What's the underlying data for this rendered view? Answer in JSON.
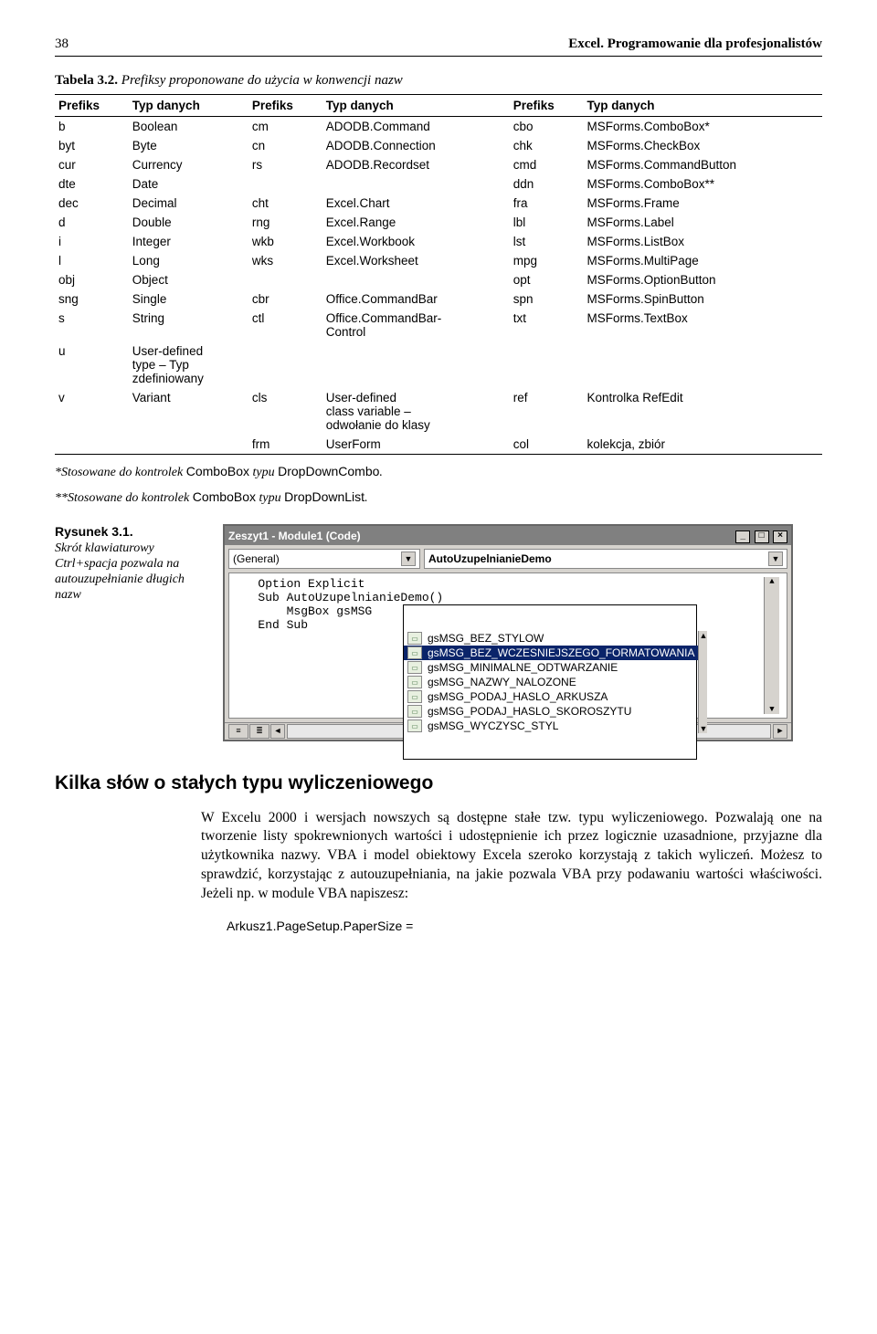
{
  "header": {
    "page": "38",
    "title": "Excel. Programowanie dla profesjonalistów"
  },
  "table_caption_bold": "Tabela 3.2.",
  "table_caption_italic": "Prefiksy proponowane do użycia w konwencji nazw",
  "th": [
    "Prefiks",
    "Typ danych",
    "Prefiks",
    "Typ danych",
    "Prefiks",
    "Typ danych"
  ],
  "rows": [
    [
      "b",
      "Boolean",
      "cm",
      "ADODB.Command",
      "cbo",
      "MSForms.ComboBox*"
    ],
    [
      "byt",
      "Byte",
      "cn",
      "ADODB.Connection",
      "chk",
      "MSForms.CheckBox"
    ],
    [
      "cur",
      "Currency",
      "rs",
      "ADODB.Recordset",
      "cmd",
      "MSForms.CommandButton"
    ],
    [
      "dte",
      "Date",
      "",
      "",
      "ddn",
      "MSForms.ComboBox**"
    ],
    [
      "dec",
      "Decimal",
      "cht",
      "Excel.Chart",
      "fra",
      "MSForms.Frame"
    ],
    [
      "d",
      "Double",
      "rng",
      "Excel.Range",
      "lbl",
      "MSForms.Label"
    ],
    [
      "i",
      "Integer",
      "wkb",
      "Excel.Workbook",
      "lst",
      "MSForms.ListBox"
    ],
    [
      "l",
      "Long",
      "wks",
      "Excel.Worksheet",
      "mpg",
      "MSForms.MultiPage"
    ],
    [
      "obj",
      "Object",
      "",
      "",
      "opt",
      "MSForms.OptionButton"
    ],
    [
      "sng",
      "Single",
      "cbr",
      "Office.CommandBar",
      "spn",
      "MSForms.SpinButton"
    ],
    [
      "s",
      "String",
      "ctl",
      "Office.CommandBar-\nControl",
      "txt",
      "MSForms.TextBox"
    ],
    [
      "u",
      "User-defined\ntype – Typ\nzdefiniowany",
      "",
      "",
      "",
      ""
    ],
    [
      "v",
      "Variant",
      "cls",
      "User-defined\nclass variable –\nodwołanie do klasy",
      "ref",
      "Kontrolka RefEdit"
    ],
    [
      "",
      "",
      "frm",
      "UserForm",
      "col",
      "kolekcja, zbiór"
    ]
  ],
  "footnote1_a": "*Stosowane do kontrolek ",
  "footnote1_b": "ComboBox",
  "footnote1_c": " typu ",
  "footnote1_d": "DropDownCombo",
  "footnote1_e": ".",
  "footnote2_a": "**Stosowane do kontrolek ",
  "footnote2_b": "ComboBox",
  "footnote2_c": " typu ",
  "footnote2_d": "DropDownList",
  "footnote2_e": ".",
  "fig_label": "Rysunek 3.1.",
  "fig_text": "Skrót klawiaturowy Ctrl+spacja pozwala na autouzupełnianie długich nazw",
  "ss": {
    "title": "Zeszyt1 - Module1 (Code)",
    "dd_left": "(General)",
    "dd_right": "AutoUzupelnianieDemo",
    "code_lines": [
      "   Option Explicit",
      "   Sub AutoUzupelnianieDemo()",
      "       MsgBox gsMSG",
      "   End Sub"
    ],
    "ac": [
      "gsMSG_BEZ_STYLOW",
      "gsMSG_BEZ_WCZESNIEJSZEGO_FORMATOWANIA",
      "gsMSG_MINIMALNE_ODTWARZANIE",
      "gsMSG_NAZWY_NALOZONE",
      "gsMSG_PODAJ_HASLO_ARKUSZA",
      "gsMSG_PODAJ_HASLO_SKOROSZYTU",
      "gsMSG_WYCZYSC_STYL"
    ],
    "ac_selected": 1
  },
  "section": "Kilka słów o stałych typu wyliczeniowego",
  "paragraph": "W Excelu 2000 i wersjach nowszych są dostępne stałe tzw. typu wyliczeniowego. Pozwalają one na tworzenie listy spokrewnionych wartości i udostępnienie ich przez logicznie uzasadnione, przyjazne dla użytkownika nazwy. VBA i model obiektowy Excela szeroko korzystają z takich wyliczeń. Możesz to sprawdzić, korzystając z autouzupełniania, na jakie pozwala VBA przy podawaniu wartości właściwości. Jeżeli np. w module VBA napiszesz:",
  "code": "Arkusz1.PageSetup.PaperSize ="
}
